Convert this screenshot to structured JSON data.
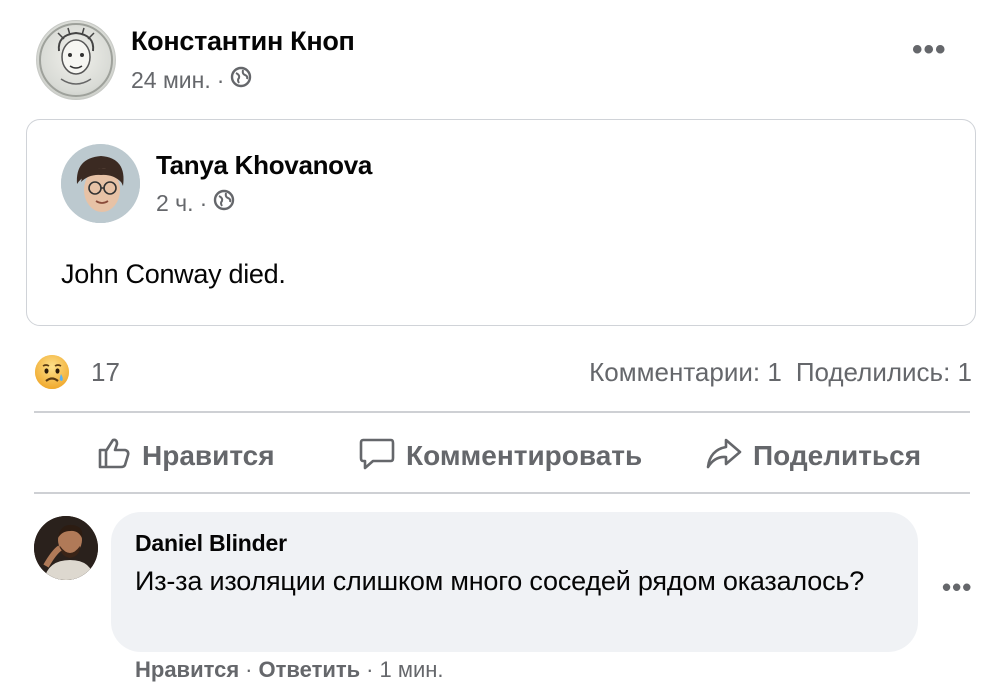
{
  "post": {
    "author_name": "Константин Кноп",
    "time": "24 мин.",
    "separator": "·",
    "privacy_icon": "globe-icon",
    "more_icon": "more-horizontal-icon",
    "more_label": "•••"
  },
  "shared_post": {
    "author_name": "Tanya Khovanova",
    "time": "2 ч.",
    "separator": "·",
    "privacy_icon": "globe-icon",
    "text": "John Conway died."
  },
  "reactions": {
    "icon": "sad-reaction-icon",
    "count": "17",
    "comments": "Комментарии: 1",
    "shares": "Поделились: 1"
  },
  "actions": {
    "like": "Нравится",
    "comment": "Комментировать",
    "share": "Поделиться"
  },
  "comment": {
    "author_name": "Daniel Blinder",
    "text": "Из-за изоляции слишком много соседей рядом оказалось?",
    "more_label": "•••",
    "like": "Нравится",
    "reply": "Ответить",
    "time": "1 мин.",
    "separator": "·"
  },
  "colors": {
    "secondary_text": "#65676b",
    "bubble_bg": "#f0f2f5",
    "divider": "#ced0d4",
    "reaction_yellow": "#f7c04a"
  }
}
